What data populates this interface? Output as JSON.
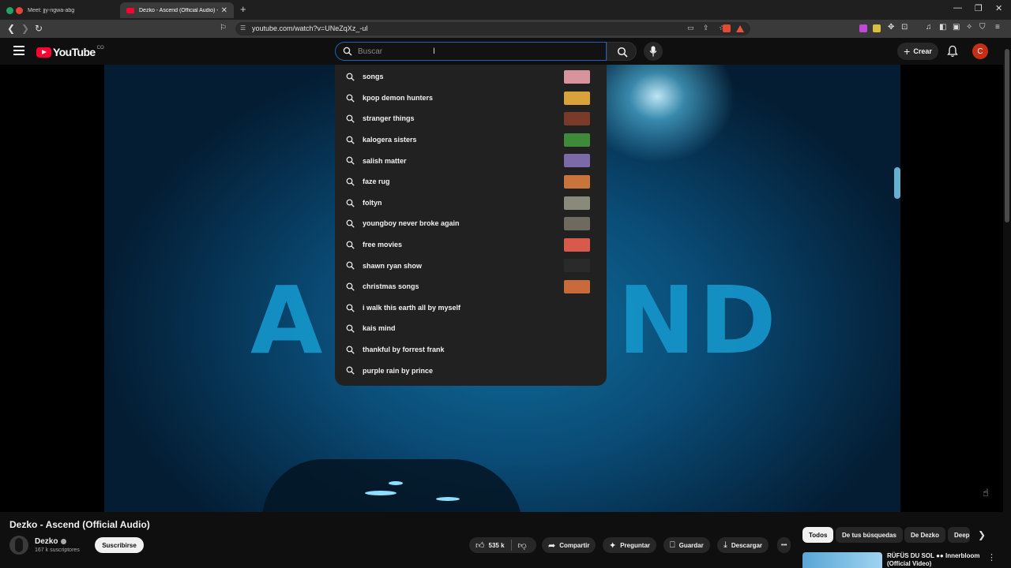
{
  "browser": {
    "tabs": [
      {
        "title": "Meet: jjy-ngwa-abg",
        "active": false
      },
      {
        "title": "Dezko - Ascend (Official Audio) - YouTube",
        "active": true
      }
    ],
    "url": "youtube.com/watch?v=UNeZqXz_-uI",
    "new_tab": "+",
    "window_controls": [
      "—",
      "❐",
      "✕"
    ]
  },
  "masthead": {
    "logo_text": "YouTube",
    "logo_suffix": "CO",
    "search_placeholder": "Buscar",
    "create_label": "Crear",
    "avatar_letter": "C"
  },
  "suggestions": [
    {
      "text": "songs",
      "thumb": "#d8949c"
    },
    {
      "text": "kpop demon hunters",
      "thumb": "#d9a23a"
    },
    {
      "text": "stranger things",
      "thumb": "#7a3a2a"
    },
    {
      "text": "kalogera sisters",
      "thumb": "#3f8a3a"
    },
    {
      "text": "salish matter",
      "thumb": "#7c6aa8"
    },
    {
      "text": "faze rug",
      "thumb": "#c8743a"
    },
    {
      "text": "foltyn",
      "thumb": "#8a8a7a"
    },
    {
      "text": "youngboy never broke again",
      "thumb": "#6f6a60"
    },
    {
      "text": "free movies",
      "thumb": "#d85a4a"
    },
    {
      "text": "shawn ryan show",
      "thumb": "#2a2a2a"
    },
    {
      "text": "christmas songs",
      "thumb": "#c86a3a"
    },
    {
      "text": "i walk this earth all by myself",
      "thumb": ""
    },
    {
      "text": "kais mind",
      "thumb": ""
    },
    {
      "text": "thankful by forrest frank",
      "thumb": ""
    },
    {
      "text": "purple rain by prince",
      "thumb": ""
    }
  ],
  "video": {
    "overlay_word_left": "A",
    "overlay_word_right": "ND",
    "title": "Dezko - Ascend (Official Audio)",
    "channel": "Dezko",
    "subscribers": "167 k suscriptores",
    "subscribe_label": "Suscribirse",
    "likes": "535 k",
    "share_label": "Compartir",
    "ask_label": "Preguntar",
    "save_label": "Guardar",
    "download_label": "Descargar",
    "more_label": "•••"
  },
  "chips": [
    "Todos",
    "De tus búsquedas",
    "De Dezko",
    "Deep"
  ],
  "recommendation": {
    "title": "RÜFÜS DU SOL ●● Innerbloom (Official Video)"
  },
  "colors": {
    "accent_red": "#ff0033",
    "search_focus": "#1c62b9",
    "avatar_bg": "#c62d14"
  }
}
